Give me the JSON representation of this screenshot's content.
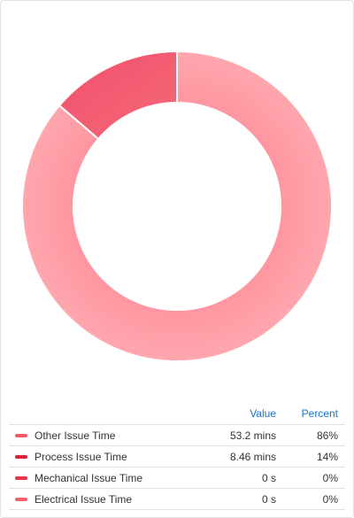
{
  "chart_data": {
    "type": "pie",
    "donut": true,
    "legend_position": "bottom",
    "columns": {
      "value": "Value",
      "percent": "Percent"
    },
    "series": [
      {
        "name": "Other Issue Time",
        "value_label": "53.2 mins",
        "value": 53.2,
        "percent_label": "86%",
        "percent": 86,
        "color": "#ff9aa4",
        "legend_color": "#f25868"
      },
      {
        "name": "Process Issue Time",
        "value_label": "8.46 mins",
        "value": 8.46,
        "percent_label": "14%",
        "percent": 14,
        "color": "#f05a74",
        "legend_color": "#d9213d"
      },
      {
        "name": "Mechanical Issue Time",
        "value_label": "0 s",
        "value": 0,
        "percent_label": "0%",
        "percent": 0,
        "color": "#f25868",
        "legend_color": "#e8364b"
      },
      {
        "name": "Electrical Issue Time",
        "value_label": "0 s",
        "value": 0,
        "percent_label": "0%",
        "percent": 0,
        "color": "#f25868",
        "legend_color": "#f2606a"
      }
    ]
  }
}
